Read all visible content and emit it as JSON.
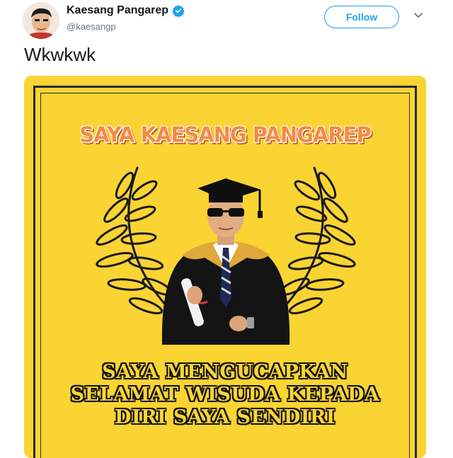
{
  "tweet": {
    "author_name": "Kaesang Pangarep",
    "author_handle": "@kaesangp",
    "follow_label": "Follow",
    "text": "Wkwkwk"
  },
  "image": {
    "headline": "SAYA KAESANG PANGAREP",
    "lines": [
      "SAYA MENGUCAPKAN",
      "SELAMAT WISUDA KEPADA",
      "DIRI SAYA SENDIRI"
    ]
  },
  "icons": {
    "verified": "verified-badge-icon",
    "caret": "chevron-down-icon"
  },
  "colors": {
    "accent": "#1da1f2",
    "card_background": "#f9d433",
    "headline": "#f48b43",
    "text": "#14171a",
    "muted": "#657786"
  }
}
